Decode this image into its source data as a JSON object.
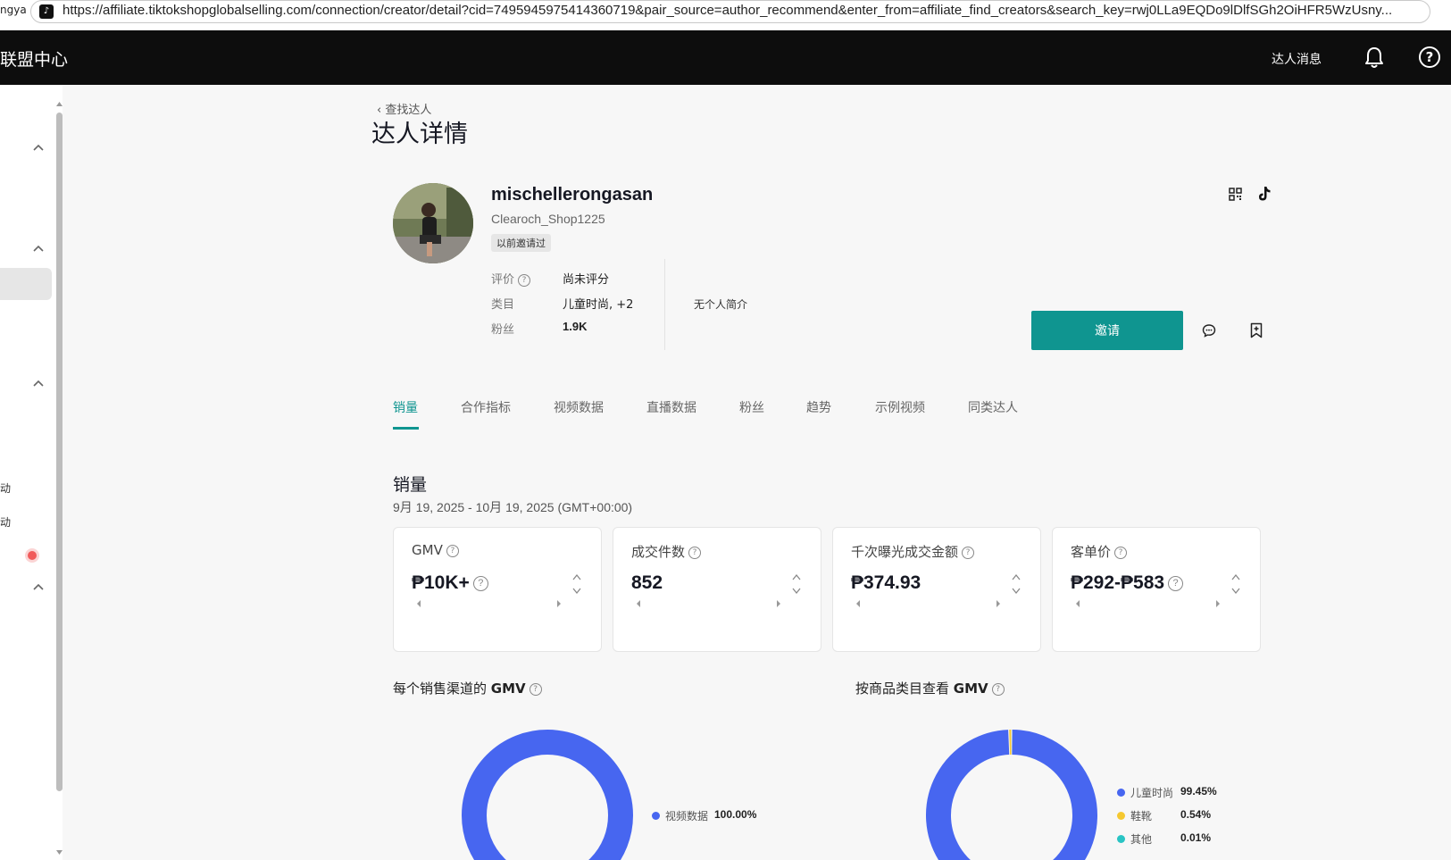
{
  "browser": {
    "left_tab_fragment": "ngya",
    "url": "https://affiliate.tiktokshopglobalselling.com/connection/creator/detail?cid=7495945975414360719&pair_source=author_recommend&enter_from=affiliate_find_creators&search_key=rwj0LLa9EQDo9lDlfSGh2OiHFR5WzUsny..."
  },
  "nav": {
    "brand": "联盟中心",
    "messages": "达人消息",
    "help_glyph": "?"
  },
  "sidebar": {
    "items": [
      "动",
      "动"
    ]
  },
  "page": {
    "back_link": "查找达人",
    "title": "达人详情"
  },
  "creator": {
    "username": "mischellerongasan",
    "shop": "Clearoch_Shop1225",
    "tag": "以前邀请过",
    "rating_label": "评价",
    "rating_value": "尚未评分",
    "category_label": "类目",
    "category_value": "儿童时尚, +2",
    "followers_label": "粉丝",
    "followers_value": "1.9K",
    "bio": "无个人简介",
    "invite_button": "邀请"
  },
  "tabs": [
    {
      "label": "销量",
      "active": true
    },
    {
      "label": "合作指标",
      "active": false
    },
    {
      "label": "视频数据",
      "active": false
    },
    {
      "label": "直播数据",
      "active": false
    },
    {
      "label": "粉丝",
      "active": false
    },
    {
      "label": "趋势",
      "active": false
    },
    {
      "label": "示例视频",
      "active": false
    },
    {
      "label": "同类达人",
      "active": false
    }
  ],
  "sales": {
    "title": "销量",
    "date_range": "9月 19, 2025 - 10月 19, 2025 (GMT+00:00)",
    "metrics": [
      {
        "label": "GMV",
        "value": "₱10K+"
      },
      {
        "label": "成交件数",
        "value": "852"
      },
      {
        "label": "千次曝光成交金额",
        "value": "₱374.93"
      },
      {
        "label": "客单价",
        "value": "₱292-₱583"
      }
    ]
  },
  "channel_chart": {
    "title_prefix": "每个销售渠道的",
    "title_bold": "GMV",
    "legend": [
      {
        "label": "视频数据",
        "value": "100.00%",
        "pct": 100.0,
        "color": "#4766f0"
      }
    ]
  },
  "category_chart": {
    "title_prefix": "按商品类目查看",
    "title_bold": "GMV",
    "legend": [
      {
        "label": "儿童时尚",
        "value": "99.45%",
        "pct": 99.45,
        "color": "#4766f0"
      },
      {
        "label": "鞋靴",
        "value": "0.54%",
        "pct": 0.54,
        "color": "#f5c830"
      },
      {
        "label": "其他",
        "value": "0.01%",
        "pct": 0.01,
        "color": "#29c4c4"
      }
    ]
  },
  "colors": {
    "accent": "#0f9590",
    "nav_bg": "#0d0d0d",
    "chart_blue": "#4766f0"
  }
}
